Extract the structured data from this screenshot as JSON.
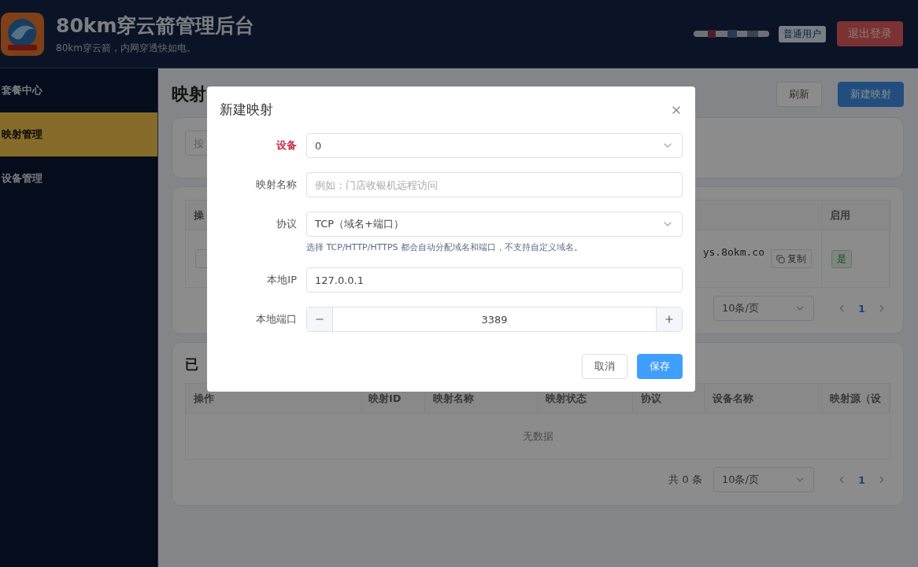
{
  "header": {
    "title": "80km穿云箭管理后台",
    "subtitle": "80km穿云箭，内网穿透快如电。",
    "user_badge": "普通用户",
    "logout": "退出登录"
  },
  "sidebar": {
    "items": [
      {
        "label": "套餐中心",
        "selected": false
      },
      {
        "label": "映射管理",
        "selected": true
      },
      {
        "label": "设备管理",
        "selected": false
      }
    ]
  },
  "page": {
    "title": "映射",
    "buttons": [
      {
        "label": "刷新",
        "primary": false
      },
      {
        "label": "新建映射",
        "primary": true
      }
    ]
  },
  "search": {
    "placeholder": "按"
  },
  "mapping_table": {
    "columns": [
      "操",
      "启用"
    ],
    "rows": [
      {
        "address": "ys.8okm.co",
        "copy": "复制",
        "enabled": "是"
      }
    ],
    "page_size": "10条/页",
    "pages": [
      {
        "label": "1",
        "selected": true
      }
    ]
  },
  "deleted": {
    "title": "已",
    "columns": [
      "操作",
      "映射ID",
      "映射名称",
      "映射状态",
      "协议",
      "设备名称",
      "映射源（设"
    ],
    "empty": "无数据",
    "total": "共 0 条",
    "page_size": "10条/页",
    "pages": [
      {
        "label": "1",
        "selected": true
      }
    ]
  },
  "dialog": {
    "title": "新建映射",
    "fields": [
      {
        "kind": "select",
        "label": "设备",
        "required": true,
        "value": "0"
      },
      {
        "kind": "text",
        "label": "映射名称",
        "required": false,
        "placeholder": "例如：门店收银机远程访问"
      },
      {
        "kind": "select",
        "label": "协议",
        "required": false,
        "value": "TCP（域名+端口）",
        "hint": "选择 TCP/HTTP/HTTPS 都会自动分配域名和端口，不支持自定义域名。"
      },
      {
        "kind": "text",
        "label": "本地IP",
        "required": false,
        "value": "127.0.0.1"
      },
      {
        "kind": "number",
        "label": "本地端口",
        "required": false,
        "value": "3389"
      }
    ],
    "buttons": [
      {
        "label": "取消",
        "primary": false
      },
      {
        "label": "保存",
        "primary": true
      }
    ]
  }
}
